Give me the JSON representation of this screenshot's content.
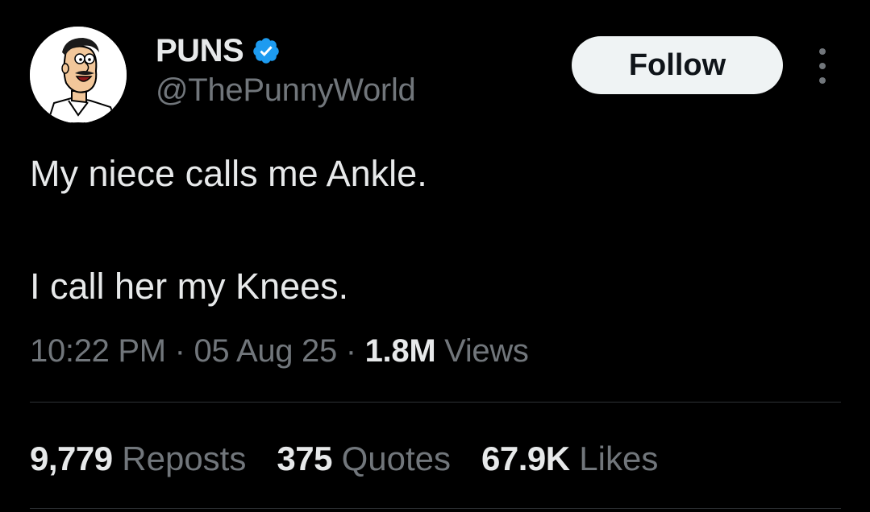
{
  "author": {
    "display_name": "PUNS",
    "handle": "@ThePunnyWorld",
    "verified_color": "#1d9bf0"
  },
  "actions": {
    "follow_label": "Follow",
    "more_icon": "more-vertical-icon"
  },
  "tweet": {
    "line1": "My niece calls me Ankle.",
    "line2": "I call her my Knees."
  },
  "meta": {
    "time": "10:22 PM",
    "sep1": " · ",
    "date": "05 Aug 25",
    "sep2": " · ",
    "views_count": "1.8M",
    "views_label": " Views"
  },
  "stats": {
    "reposts_count": "9,779",
    "reposts_label": " Reposts",
    "quotes_count": "375",
    "quotes_label": " Quotes",
    "likes_count": "67.9K",
    "likes_label": " Likes"
  },
  "colors": {
    "background": "#000000",
    "primary_text": "#e7e9ea",
    "secondary_text": "#71767b",
    "divider": "#2f3336",
    "button_bg": "#eff3f4"
  }
}
